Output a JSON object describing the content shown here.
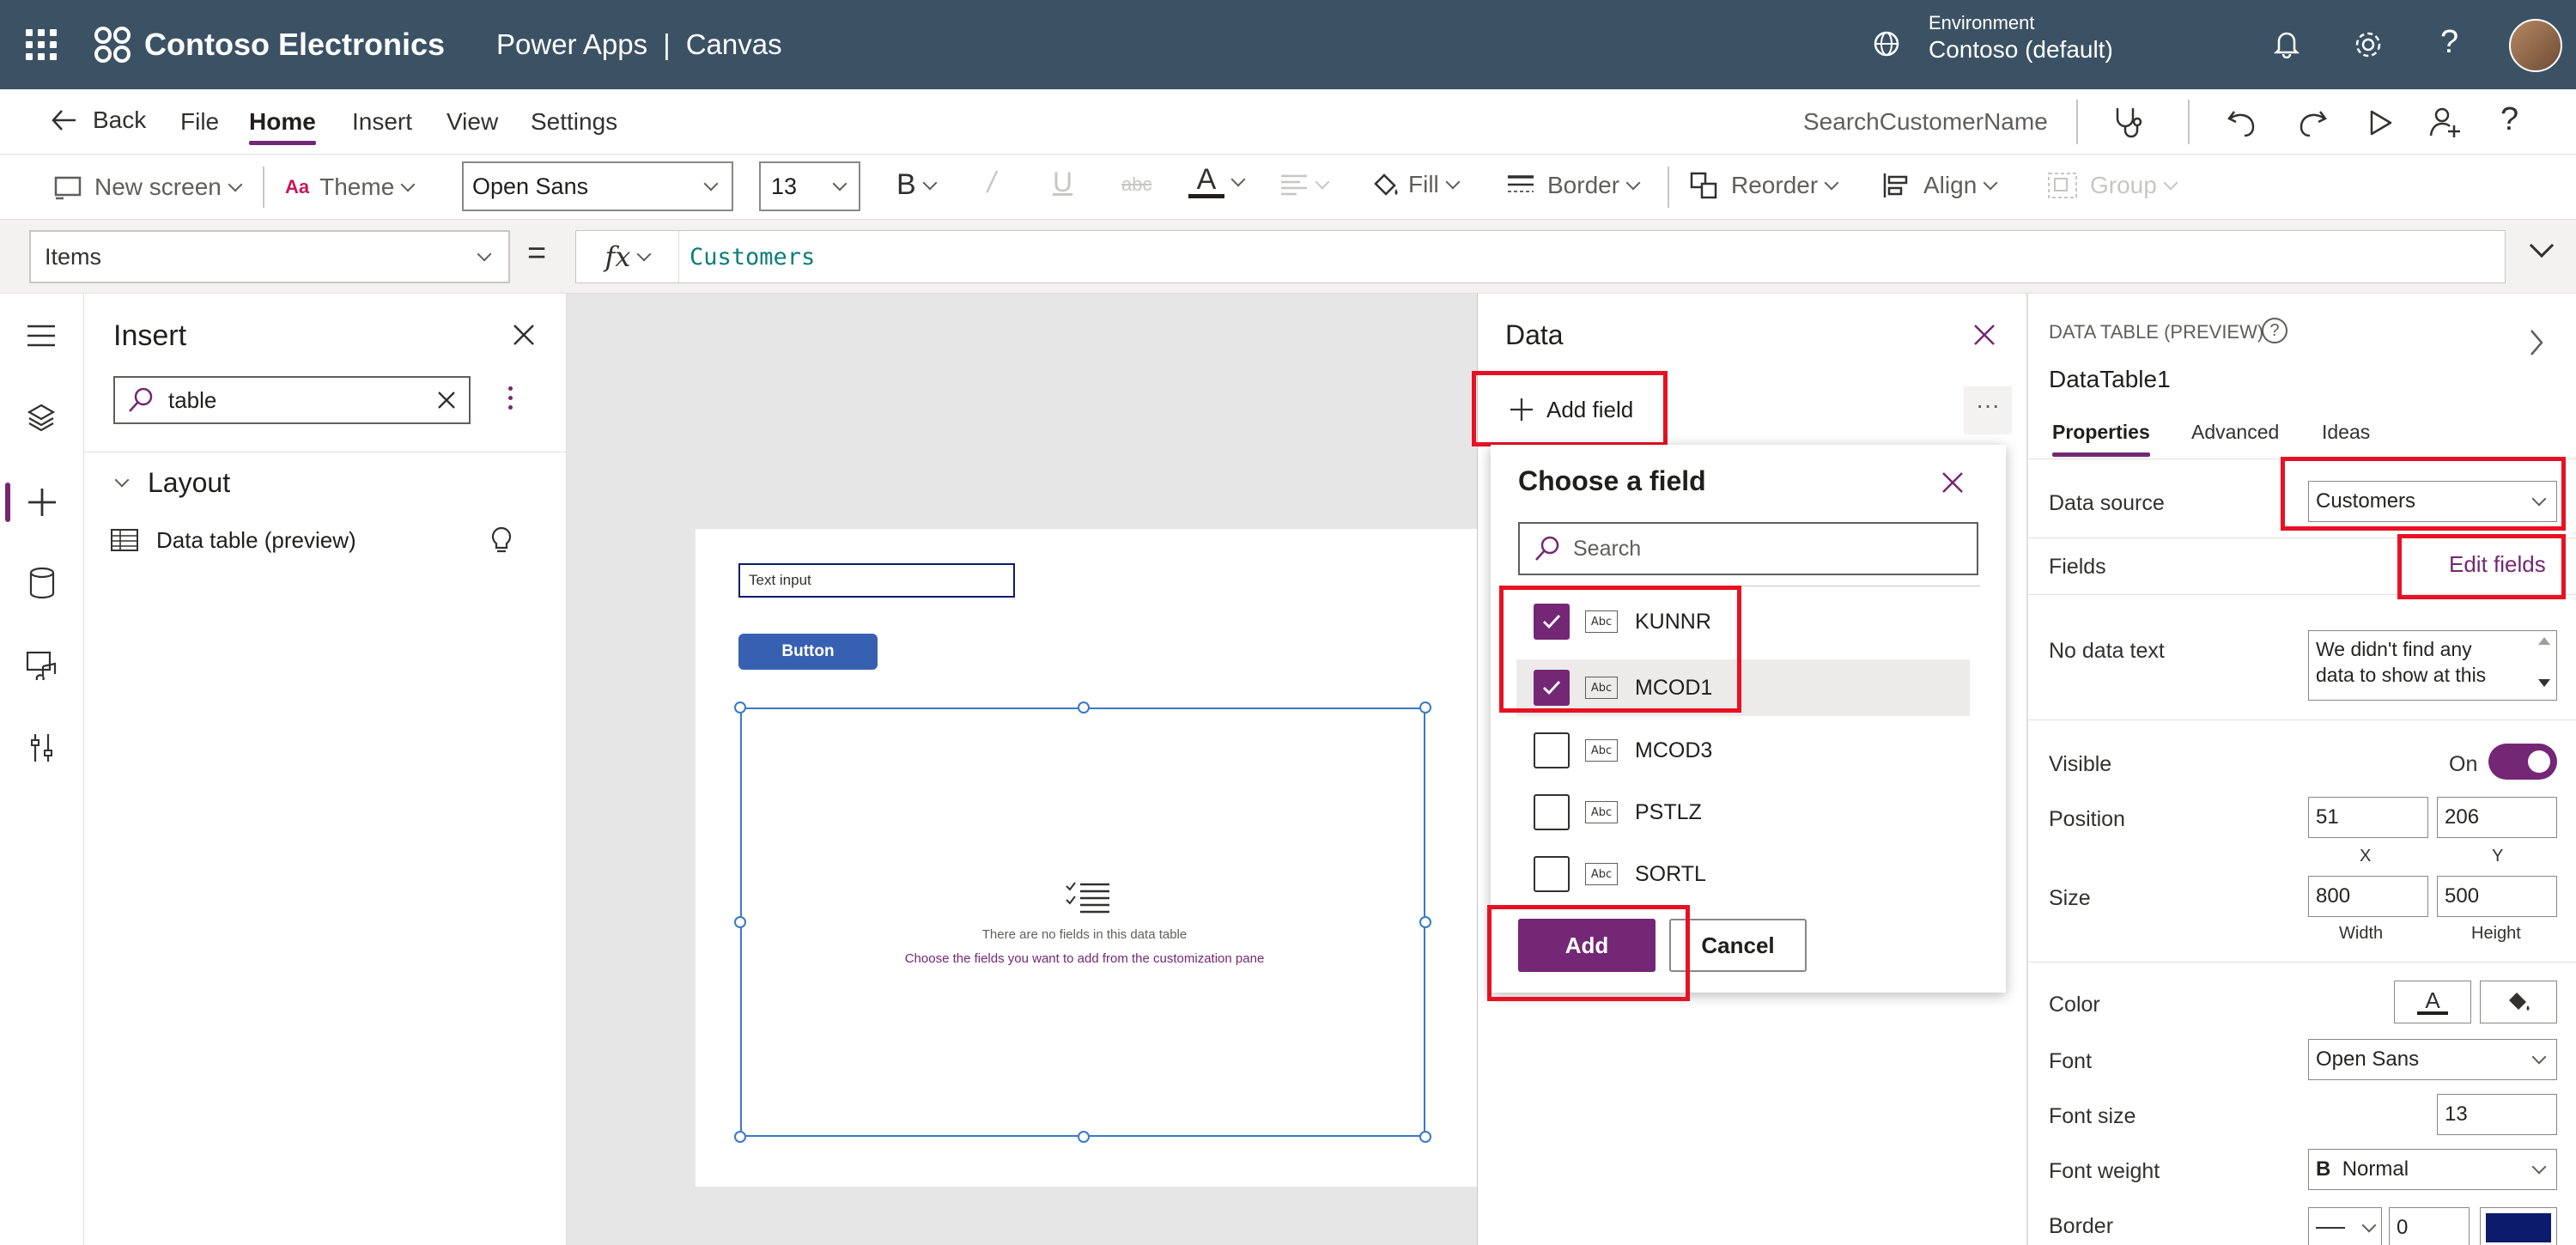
{
  "header": {
    "brand": "Contoso Electronics",
    "app": "Power Apps",
    "separator": "|",
    "mode": "Canvas",
    "environment_label": "Environment",
    "environment_value": "Contoso (default)",
    "bg_color": "#3b5265"
  },
  "command_bar": {
    "back": "Back",
    "menus": [
      "File",
      "Home",
      "Insert",
      "View",
      "Settings"
    ],
    "active_menu": "Home",
    "screen_name": "SearchCustomerName",
    "accent": "#742774"
  },
  "ribbon": {
    "new_screen": "New screen",
    "theme": "Theme",
    "font": "Open Sans",
    "font_size": "13",
    "bold": "B",
    "fill": "Fill",
    "border": "Border",
    "reorder": "Reorder",
    "align": "Align",
    "group": "Group"
  },
  "formula": {
    "property": "Items",
    "equals": "=",
    "fx": "fx",
    "value": "Customers"
  },
  "insert_pane": {
    "title": "Insert",
    "search_value": "table",
    "section": "Layout",
    "item": "Data table (preview)"
  },
  "canvas": {
    "text_input": "Text input",
    "button": "Button",
    "empty_line1": "There are no fields in this data table",
    "empty_line2": "Choose the fields you want to add from the customization pane"
  },
  "data_panel": {
    "title": "Data",
    "add_field": "Add field",
    "more": "···",
    "popup_title": "Choose a field",
    "search_placeholder": "Search",
    "fields": [
      {
        "name": "KUNNR",
        "checked": true
      },
      {
        "name": "MCOD1",
        "checked": true
      },
      {
        "name": "MCOD3",
        "checked": false
      },
      {
        "name": "PSTLZ",
        "checked": false
      },
      {
        "name": "SORTL",
        "checked": false
      }
    ],
    "field_icon": "Abc",
    "add_button": "Add",
    "cancel_button": "Cancel"
  },
  "properties": {
    "type_label": "DATA TABLE (PREVIEW)",
    "control_name": "DataTable1",
    "tabs": [
      "Properties",
      "Advanced",
      "Ideas"
    ],
    "data_source_label": "Data source",
    "data_source_value": "Customers",
    "fields_label": "Fields",
    "edit_fields": "Edit fields",
    "no_data_label": "No data text",
    "no_data_value": "We didn't find any data to show at this",
    "visible_label": "Visible",
    "visible_value": "On",
    "position_label": "Position",
    "pos_x": "51",
    "pos_y": "206",
    "x_label": "X",
    "y_label": "Y",
    "size_label": "Size",
    "width": "800",
    "height": "500",
    "width_label": "Width",
    "height_label": "Height",
    "color_label": "Color",
    "color_glyph": "A",
    "font_label": "Font",
    "font_value": "Open Sans",
    "font_size_label": "Font size",
    "font_size_value": "13",
    "font_weight_label": "Font weight",
    "font_weight_glyph": "B",
    "font_weight_value": "Normal",
    "border_label": "Border",
    "border_value": "0",
    "border_color": "#0c1b6b"
  }
}
